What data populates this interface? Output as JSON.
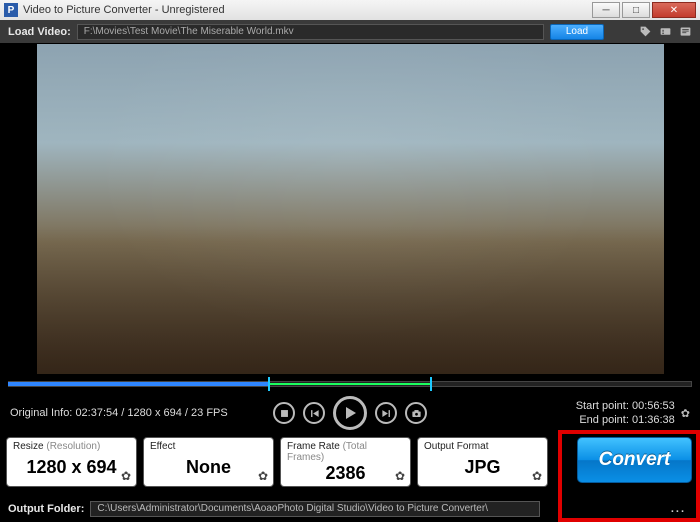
{
  "window": {
    "title": "Video to Picture Converter - Unregistered",
    "app_icon_letter": "P"
  },
  "toolbar": {
    "load_label": "Load Video:",
    "path": "F:\\Movies\\Test Movie\\The Miserable World.mkv",
    "load_button": "Load"
  },
  "timeline": {
    "played_percent": 38,
    "range_start_percent": 38,
    "range_end_percent": 62
  },
  "controls": {
    "original_info_label": "Original Info:",
    "original_info_value": "02:37:54 / 1280 x 694 / 23 FPS",
    "start_point_label": "Start point:",
    "start_point_value": "00:56:53",
    "end_point_label": "End point:",
    "end_point_value": "01:36:38"
  },
  "panels": {
    "resize": {
      "label": "Resize",
      "sublabel": "(Resolution)",
      "value": "1280 x 694"
    },
    "effect": {
      "label": "Effect",
      "value": "None"
    },
    "framerate": {
      "label": "Frame Rate",
      "sublabel": "(Total Frames)",
      "value": "2386"
    },
    "format": {
      "label": "Output Format",
      "value": "JPG"
    },
    "convert_label": "Convert"
  },
  "output": {
    "label": "Output Folder:",
    "path": "C:\\Users\\Administrator\\Documents\\AoaoPhoto Digital Studio\\Video to Picture Converter\\"
  }
}
